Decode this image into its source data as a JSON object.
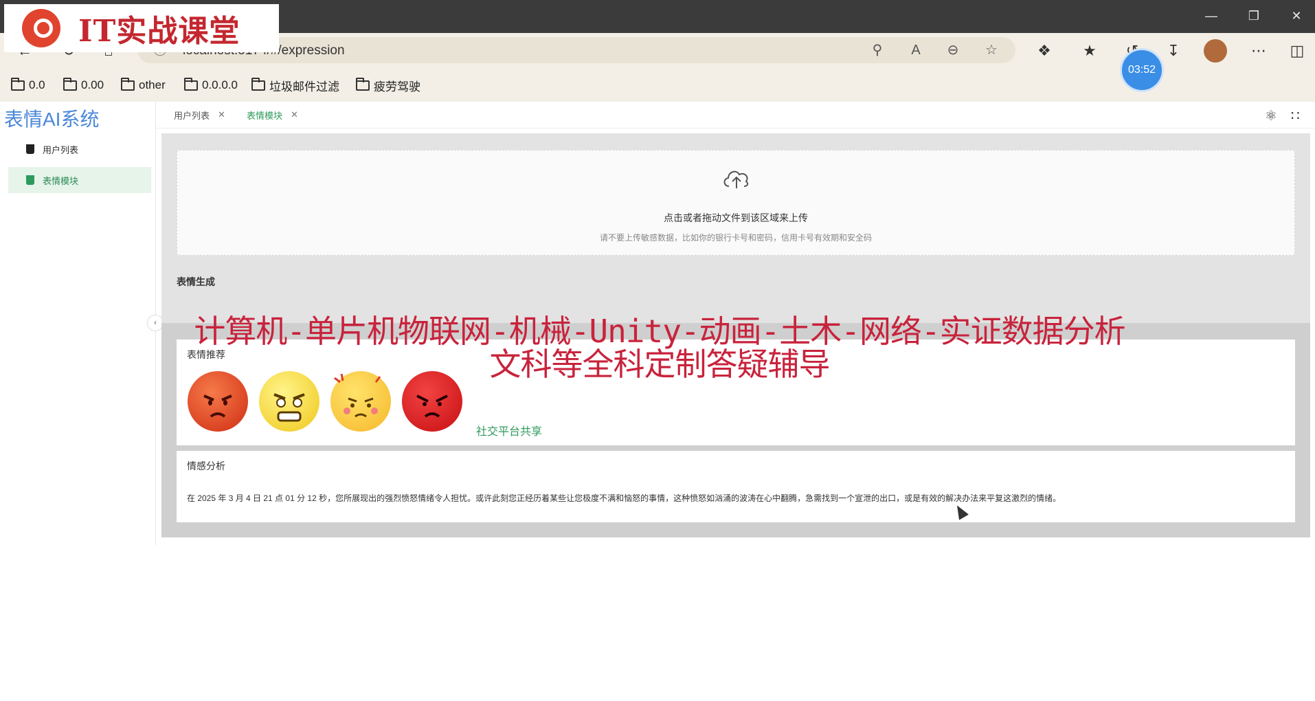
{
  "browser": {
    "url": "localhost:5174/#/expression",
    "bookmarks": [
      {
        "label": "0.0"
      },
      {
        "label": "0.00"
      },
      {
        "label": "other"
      },
      {
        "label": "0.0.0.0"
      },
      {
        "label": "垃圾邮件过滤"
      },
      {
        "label": "疲劳驾驶"
      }
    ],
    "timer": "03:52"
  },
  "logo": {
    "text": "IT实战课堂"
  },
  "app": {
    "title": "表情AI系统"
  },
  "sidebar": {
    "items": [
      {
        "label": "用户列表",
        "active": false
      },
      {
        "label": "表情模块",
        "active": true
      }
    ]
  },
  "tabs": [
    {
      "label": "用户列表",
      "active": false
    },
    {
      "label": "表情模块",
      "active": true
    }
  ],
  "upload": {
    "main_text": "点击或者拖动文件到该区域来上传",
    "sub_text": "请不要上传敏感数据，比如你的银行卡号和密码，信用卡号有效期和安全码"
  },
  "generate": {
    "title": "表情生成"
  },
  "recommend": {
    "title": "表情推荐",
    "emojis": [
      "angry-face-icon",
      "frustrated-face-icon",
      "annoyed-face-icon",
      "red-angry-face-icon"
    ],
    "share_label": "社交平台共享"
  },
  "analysis": {
    "title": "情感分析",
    "text": "在 2025 年 3 月 4 日 21 点 01 分 12 秒，您所展现出的强烈愤怒情绪令人担忧。或许此刻您正经历着某些让您极度不满和恼怒的事情，这种愤怒如汹涌的波涛在心中翻腾，急需找到一个宣泄的出口，或是有效的解决办法来平复这激烈的情绪。"
  },
  "watermark": {
    "line1": "计算机-单片机物联网-机械-Unity-动画-土木-网络-实证数据分析",
    "line2": "文科等全科定制答疑辅导"
  },
  "colors": {
    "accent": "#2e9a5c",
    "brand": "#4a86d9",
    "watermark": "#c8233c"
  }
}
